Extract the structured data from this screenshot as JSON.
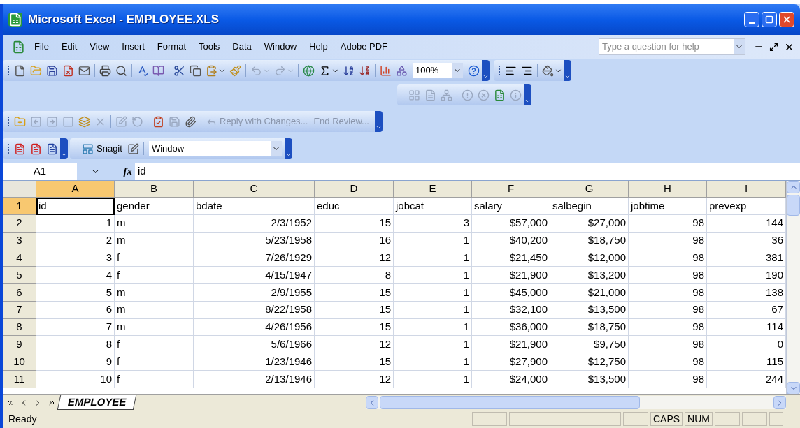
{
  "window": {
    "title": "Microsoft Excel - EMPLOYEE.XLS"
  },
  "menu": [
    "File",
    "Edit",
    "View",
    "Insert",
    "Format",
    "Tools",
    "Data",
    "Window",
    "Help",
    "Adobe PDF"
  ],
  "help_box": {
    "placeholder": "Type a question for help"
  },
  "standard_toolbar": {
    "zoom": "100%"
  },
  "reviewing_toolbar": {
    "reply": "Reply with Changes...",
    "end_review": "End Review..."
  },
  "snagit_toolbar": {
    "label": "Snagit",
    "capture_mode": "Window"
  },
  "formula_bar": {
    "name_box": "A1",
    "function_label": "fx",
    "content": "id"
  },
  "columns": [
    {
      "label": "A",
      "selected": true
    },
    {
      "label": "B",
      "selected": false
    },
    {
      "label": "C",
      "selected": false
    },
    {
      "label": "D",
      "selected": false
    },
    {
      "label": "E",
      "selected": false
    },
    {
      "label": "F",
      "selected": false
    },
    {
      "label": "G",
      "selected": false
    },
    {
      "label": "H",
      "selected": false
    },
    {
      "label": "I",
      "selected": false
    }
  ],
  "rows": [
    {
      "number": "1",
      "selected": true,
      "cells": [
        "id",
        "gender",
        "bdate",
        "educ",
        "jobcat",
        "salary",
        "salbegin",
        "jobtime",
        "prevexp"
      ]
    },
    {
      "number": "2",
      "selected": false,
      "cells": [
        "1",
        "m",
        "2/3/1952",
        "15",
        "3",
        "$57,000",
        "$27,000",
        "98",
        "144"
      ]
    },
    {
      "number": "3",
      "selected": false,
      "cells": [
        "2",
        "m",
        "5/23/1958",
        "16",
        "1",
        "$40,200",
        "$18,750",
        "98",
        "36"
      ]
    },
    {
      "number": "4",
      "selected": false,
      "cells": [
        "3",
        "f",
        "7/26/1929",
        "12",
        "1",
        "$21,450",
        "$12,000",
        "98",
        "381"
      ]
    },
    {
      "number": "5",
      "selected": false,
      "cells": [
        "4",
        "f",
        "4/15/1947",
        "8",
        "1",
        "$21,900",
        "$13,200",
        "98",
        "190"
      ]
    },
    {
      "number": "6",
      "selected": false,
      "cells": [
        "5",
        "m",
        "2/9/1955",
        "15",
        "1",
        "$45,000",
        "$21,000",
        "98",
        "138"
      ]
    },
    {
      "number": "7",
      "selected": false,
      "cells": [
        "6",
        "m",
        "8/22/1958",
        "15",
        "1",
        "$32,100",
        "$13,500",
        "98",
        "67"
      ]
    },
    {
      "number": "8",
      "selected": false,
      "cells": [
        "7",
        "m",
        "4/26/1956",
        "15",
        "1",
        "$36,000",
        "$18,750",
        "98",
        "114"
      ]
    },
    {
      "number": "9",
      "selected": false,
      "cells": [
        "8",
        "f",
        "5/6/1966",
        "12",
        "1",
        "$21,900",
        "$9,750",
        "98",
        "0"
      ]
    },
    {
      "number": "10",
      "selected": false,
      "cells": [
        "9",
        "f",
        "1/23/1946",
        "15",
        "1",
        "$27,900",
        "$12,750",
        "98",
        "115"
      ]
    },
    {
      "number": "11",
      "selected": false,
      "cells": [
        "10",
        "f",
        "2/13/1946",
        "12",
        "1",
        "$24,000",
        "$13,500",
        "98",
        "244"
      ]
    }
  ],
  "sheet_tabs": [
    {
      "label": "EMPLOYEE",
      "selected": true
    }
  ],
  "status_bar": {
    "status": "Ready",
    "indicators": [
      "CAPS",
      "NUM"
    ]
  }
}
